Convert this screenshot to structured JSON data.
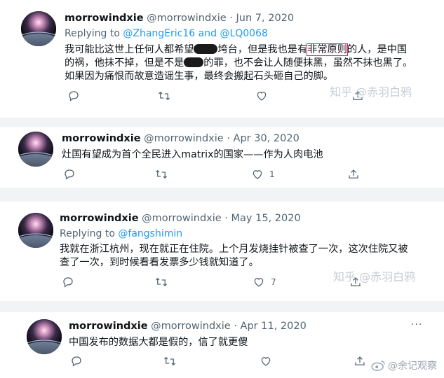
{
  "tweets": [
    {
      "name": "morrowindxie",
      "handle": "@morrowindxie",
      "sep": "·",
      "date": "Jun 7, 2020",
      "replying_prefix": "Replying to ",
      "replying_to_1": "@ZhangEric16",
      "replying_and": " and ",
      "replying_to_2": "@LQ0068",
      "text_a": "我可能比这世上任何人都希望",
      "text_b": "垮台，但是我也是有",
      "text_boxed": "非常原则",
      "text_c": "的人，是中国的祸，他抹不掉，但是不是",
      "text_d": "的罪，也不会让人随便抹黑，虽然不抹也黑了。如果因为痛恨而故意造谣生事，最终会搬起石头砸自己的脚。",
      "reply_count": "",
      "retweet_count": "",
      "like_count": ""
    },
    {
      "name": "morrowindxie",
      "handle": "@morrowindxie",
      "sep": "·",
      "date": "Apr 30, 2020",
      "text": "灶国有望成为首个全民进入matrix的国家——作为人肉电池",
      "reply_count": "",
      "retweet_count": "",
      "like_count": "1"
    },
    {
      "name": "morrowindxie",
      "handle": "@morrowindxie",
      "sep": "·",
      "date": "May 15, 2020",
      "replying_prefix": "Replying to ",
      "replying_to_1": "@fangshimin",
      "text": "我就在浙江杭州，现在就正在住院。上个月发烧挂针被查了一次，这次住院又被查了一次，到时候看看发票多少钱就知道了。",
      "reply_count": "",
      "retweet_count": "",
      "like_count": "7"
    },
    {
      "name": "morrowindxie",
      "handle": "@morrowindxie",
      "sep": "·",
      "date": "Apr 11, 2020",
      "text": "中国发布的数据大都是假的，信了就更傻",
      "reply_count": "",
      "retweet_count": "",
      "like_count": "",
      "more": "···"
    }
  ],
  "watermarks": {
    "zhihu_1": "知乎 @赤羽白鸦",
    "zhihu_2": "知乎 @赤羽白鸦",
    "weibo": "@余记观察"
  },
  "icons": {
    "reply": "reply-icon",
    "retweet": "retweet-icon",
    "like": "like-icon",
    "share": "share-icon",
    "more": "more-icon",
    "weibo": "weibo-logo"
  },
  "colors": {
    "link": "#1d9bf0",
    "meta": "#536471",
    "text": "#0f1419",
    "separator": "#f2f3f5",
    "highlight_box": "#e0245e"
  }
}
